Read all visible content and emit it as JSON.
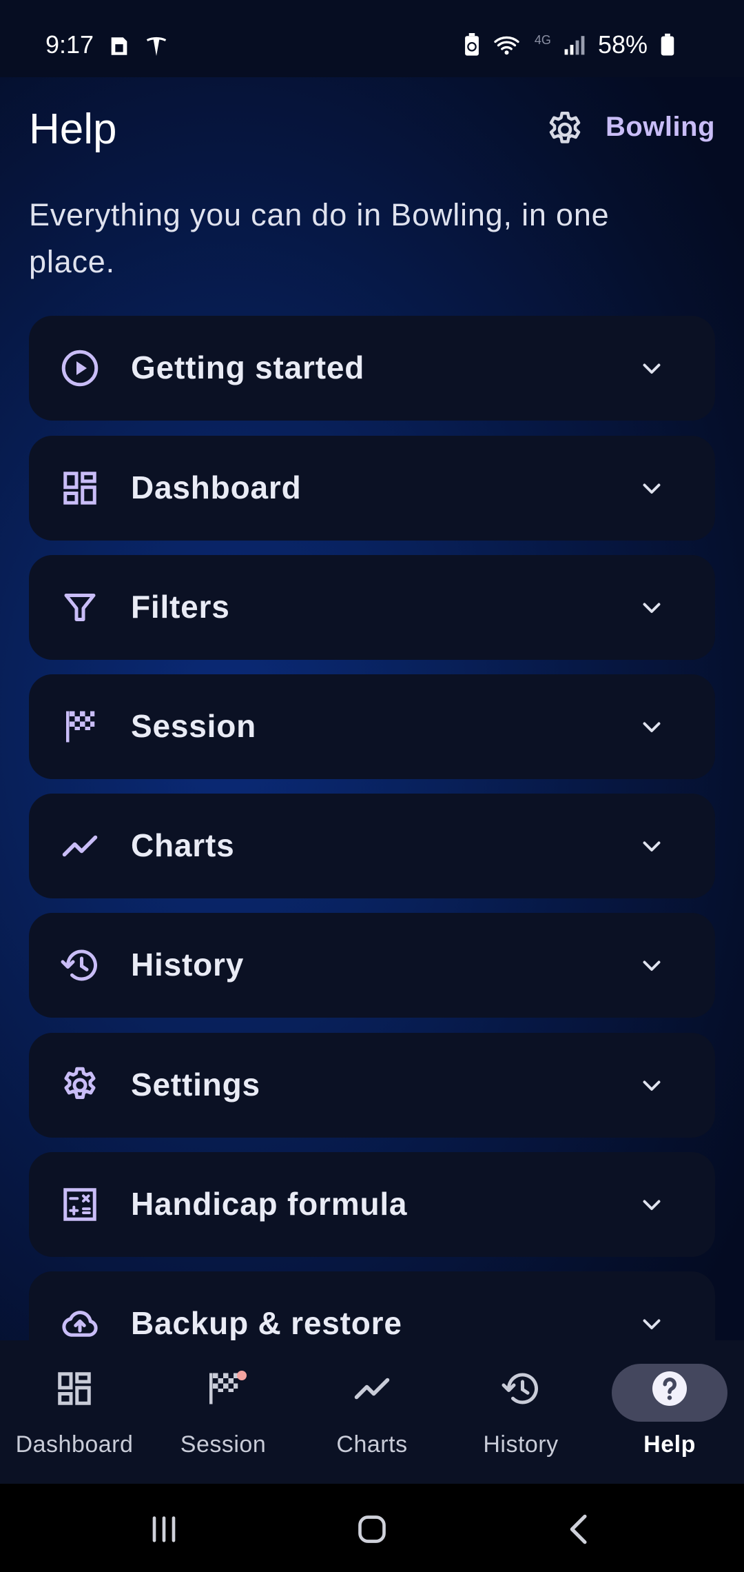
{
  "status_bar": {
    "time": "9:17",
    "battery_percent": "58%",
    "network": "4G",
    "icons": [
      "sim-icon",
      "tesla-icon",
      "battery-saver-icon",
      "wifi-icon",
      "signal-icon",
      "battery-icon"
    ]
  },
  "header": {
    "title": "Help",
    "brand": "Bowling",
    "settings_icon": "gear-icon"
  },
  "subtitle": "Everything you can do in Bowling, in one place.",
  "sections": [
    {
      "label": "Getting started",
      "icon": "play-circle-icon"
    },
    {
      "label": "Dashboard",
      "icon": "dashboard-icon"
    },
    {
      "label": "Filters",
      "icon": "filter-icon"
    },
    {
      "label": "Session",
      "icon": "checkered-flag-icon"
    },
    {
      "label": "Charts",
      "icon": "trend-line-icon"
    },
    {
      "label": "History",
      "icon": "history-icon"
    },
    {
      "label": "Settings",
      "icon": "gear-icon"
    },
    {
      "label": "Handicap formula",
      "icon": "calculator-icon"
    },
    {
      "label": "Backup & restore",
      "icon": "cloud-upload-icon"
    }
  ],
  "bottom_nav": {
    "items": [
      {
        "label": "Dashboard",
        "icon": "dashboard-icon",
        "active": false
      },
      {
        "label": "Session",
        "icon": "checkered-flag-icon",
        "active": false,
        "badge": true
      },
      {
        "label": "Charts",
        "icon": "trend-line-icon",
        "active": false
      },
      {
        "label": "History",
        "icon": "history-icon",
        "active": false
      },
      {
        "label": "Help",
        "icon": "help-circle-icon",
        "active": true
      }
    ]
  },
  "system_nav": [
    "recents-icon",
    "home-icon",
    "back-icon"
  ],
  "colors": {
    "accent": "#c9bdf7",
    "card": "#0b1124",
    "active_pill": "#44475e",
    "badge": "#f3a3a0"
  }
}
